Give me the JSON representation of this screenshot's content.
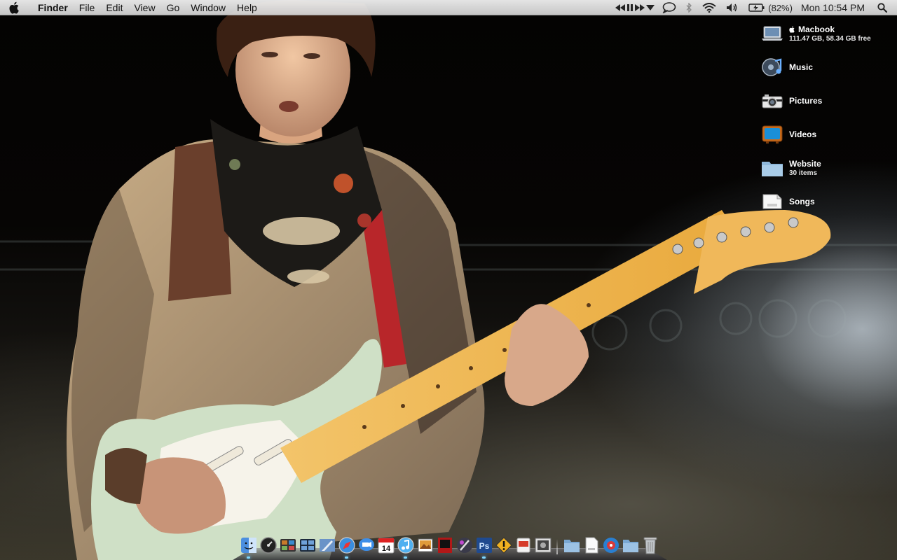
{
  "menubar": {
    "app_name": "Finder",
    "menus": [
      "File",
      "Edit",
      "View",
      "Go",
      "Window",
      "Help"
    ],
    "battery_percent": "(82%)",
    "clock": "Mon 10:54 PM",
    "status_icons": [
      "media-prev-icon",
      "media-play-pause-icon",
      "media-next-icon",
      "media-menu-arrow-icon",
      "chat-bubble-icon",
      "bluetooth-icon",
      "wifi-icon",
      "volume-icon",
      "battery-icon",
      "spotlight-search-icon"
    ]
  },
  "desktop": {
    "items": [
      {
        "name": "Macbook",
        "subtitle": "111.47 GB, 58.34 GB free",
        "icon": "laptop-icon"
      },
      {
        "name": "Music",
        "subtitle": "",
        "icon": "music-folder-icon"
      },
      {
        "name": "Pictures",
        "subtitle": "",
        "icon": "camera-icon"
      },
      {
        "name": "Videos",
        "subtitle": "",
        "icon": "tv-icon"
      },
      {
        "name": "Website",
        "subtitle": "30 items",
        "icon": "folder-icon"
      },
      {
        "name": "Songs",
        "subtitle": "",
        "icon": "document-icon"
      }
    ]
  },
  "dock": {
    "apps": [
      "finder",
      "dashboard",
      "front-row",
      "spaces",
      "mail",
      "safari",
      "ichat",
      "ical",
      "itunes",
      "iphoto",
      "photo-booth",
      "pixelmator",
      "photoshop",
      "vlc",
      "coda",
      "preview"
    ],
    "stacks": [
      "applications-folder",
      "document-stack",
      "netnewswire",
      "downloads-folder",
      "trash"
    ]
  },
  "colors": {
    "menubar": "#e6e6e6",
    "dock_indicator": "#7fd6ff",
    "icon_text": "#ffffff"
  }
}
